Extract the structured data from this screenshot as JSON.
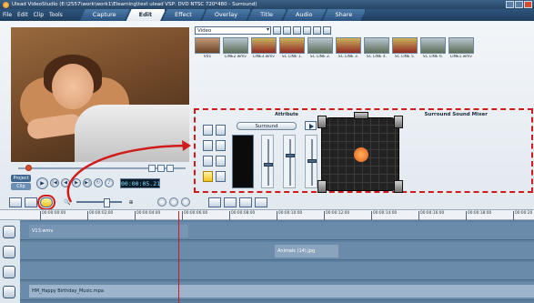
{
  "window": {
    "title": "Ulead VideoStudio (E:\\2557\\work\\work1\\Elearning\\test ulead VSP: DVD NTSC 720*480 - Surround)"
  },
  "menu": [
    "File",
    "Edit",
    "Clip",
    "Tools"
  ],
  "tabs": [
    {
      "label": "Capture",
      "active": false
    },
    {
      "label": "Edit",
      "active": true
    },
    {
      "label": "Effect",
      "active": false
    },
    {
      "label": "Overlay",
      "active": false
    },
    {
      "label": "Title",
      "active": false
    },
    {
      "label": "Audio",
      "active": false
    },
    {
      "label": "Share",
      "active": false
    }
  ],
  "player": {
    "project_label": "Project",
    "clip_label": "Clip",
    "timecode": "00:00:05.21"
  },
  "library": {
    "category": "Video",
    "thumbnails": [
      {
        "label": "V01",
        "style": "v01"
      },
      {
        "label": "LINE2.wmv",
        "style": ""
      },
      {
        "label": "LINE3.wmv",
        "style": "warn"
      },
      {
        "label": "SC LINE 1.",
        "style": "warn"
      },
      {
        "label": "SC LINE 2.",
        "style": ""
      },
      {
        "label": "SC LINE 3.",
        "style": "warn"
      },
      {
        "label": "SC LINE 4.",
        "style": ""
      },
      {
        "label": "SC LINE 5.",
        "style": "warn"
      },
      {
        "label": "SC LINE 6.",
        "style": ""
      },
      {
        "label": "LINE1.wmv",
        "style": ""
      }
    ]
  },
  "attribute": {
    "title": "Attribute",
    "mode_button": "Surround"
  },
  "mixer": {
    "title": "Surround Sound Mixer"
  },
  "ruler": {
    "ticks": [
      "00:00:00:00",
      "00:00:02:00",
      "00:00:04:00",
      "00:00:06:00",
      "00:00:08:00",
      "00:00:10:00",
      "00:00:12:00",
      "00:00:14:00",
      "00:00:16:00",
      "00:00:18:00",
      "00:00:20"
    ]
  },
  "timeline": {
    "video_clip": "V13.wmv",
    "overlay_clip": "Animals (14).jpg",
    "music_clip": "HM_Happy Birthday_Music.mpa"
  },
  "colors": {
    "highlight": "#d11b1b",
    "accent": "#2f557c"
  }
}
